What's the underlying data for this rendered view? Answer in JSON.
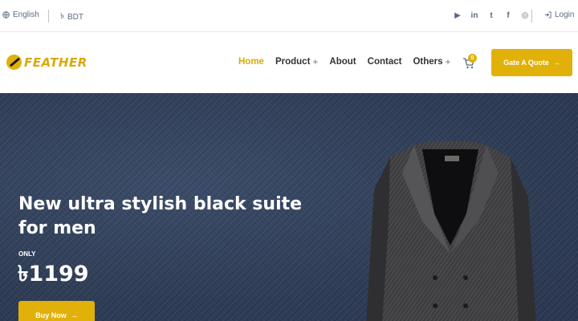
{
  "topbar": {
    "language": "English",
    "currency": "BDT",
    "socials": [
      {
        "name": "youtube-icon",
        "glyph": "▶"
      },
      {
        "name": "linkedin-icon",
        "glyph": "in"
      },
      {
        "name": "twitter-icon",
        "glyph": "t"
      },
      {
        "name": "facebook-icon",
        "glyph": "f"
      },
      {
        "name": "instagram-icon",
        "glyph": "◎"
      }
    ],
    "login": "Login"
  },
  "header": {
    "logo_text": "FEATHER",
    "nav": [
      {
        "label": "Home",
        "active": true,
        "has_plus": false
      },
      {
        "label": "Product",
        "active": false,
        "has_plus": true
      },
      {
        "label": "About",
        "active": false,
        "has_plus": false
      },
      {
        "label": "Contact",
        "active": false,
        "has_plus": false
      },
      {
        "label": "Others",
        "active": false,
        "has_plus": true
      }
    ],
    "cart_count": "0",
    "quote_button": "Gate A Quote"
  },
  "hero": {
    "headline": "New ultra stylish black suite for men",
    "only_label": "ONLY",
    "price": "৳1199",
    "buy_button": "Buy Now"
  },
  "colors": {
    "accent": "#e1b10a",
    "hero_bg": "#2f3e58",
    "topbar_text": "#5a6a84"
  }
}
